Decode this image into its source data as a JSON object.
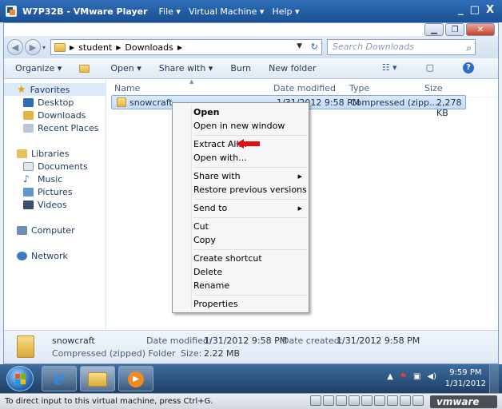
{
  "vmware": {
    "title": "W7P32B - VMware Player",
    "menu": [
      "File ▾",
      "Virtual Machine ▾",
      "Help ▾"
    ],
    "controls": [
      "_",
      "□",
      "X"
    ],
    "status_text": "To direct input to this virtual machine, press Ctrl+G.",
    "logo_text": "vmware"
  },
  "explorer": {
    "breadcrumb": [
      "student",
      "Downloads"
    ],
    "search_placeholder": "Search Downloads",
    "toolbar": {
      "organize": "Organize ▾",
      "open": "Open ▾",
      "share_with": "Share with ▾",
      "burn": "Burn",
      "new_folder": "New folder"
    },
    "nav": {
      "favorites": "Favorites",
      "desktop": "Desktop",
      "downloads": "Downloads",
      "recent_places": "Recent Places",
      "libraries": "Libraries",
      "documents": "Documents",
      "music": "Music",
      "pictures": "Pictures",
      "videos": "Videos",
      "computer": "Computer",
      "network": "Network"
    },
    "columns": {
      "name": "Name",
      "date_modified": "Date modified",
      "type": "Type",
      "size": "Size"
    },
    "file": {
      "name": "snowcraft",
      "date_modified": "1/31/2012 9:58 PM",
      "type": "Compressed (zipp...",
      "size": "2,278 KB"
    },
    "details": {
      "name": "snowcraft",
      "type": "Compressed (zipped) Folder",
      "date_modified_label": "Date modified:",
      "date_modified": "1/31/2012 9:58 PM",
      "size_label": "Size:",
      "size": "2.22 MB",
      "date_created_label": "Date created:",
      "date_created": "1/31/2012 9:58 PM"
    }
  },
  "context_menu": {
    "open": "Open",
    "open_new_window": "Open in new window",
    "extract_all": "Extract All...",
    "open_with": "Open with...",
    "share_with": "Share with",
    "restore": "Restore previous versions",
    "send_to": "Send to",
    "cut": "Cut",
    "copy": "Copy",
    "create_shortcut": "Create shortcut",
    "delete": "Delete",
    "rename": "Rename",
    "properties": "Properties"
  },
  "taskbar": {
    "time": "9:59 PM",
    "date": "1/31/2012"
  },
  "colors": {
    "vm_title_bg": "#1b4f93",
    "selection": "#c4dbf8",
    "annotation_arrow": "#e01010"
  }
}
